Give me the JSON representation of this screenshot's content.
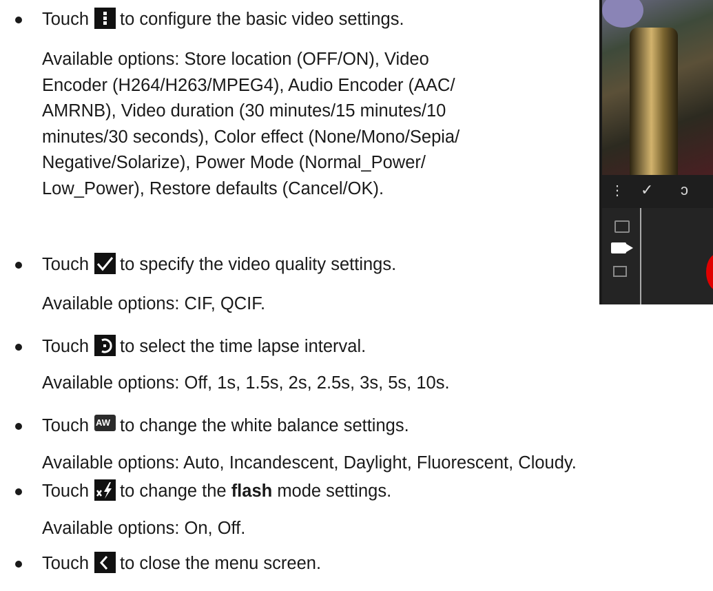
{
  "items": [
    {
      "touch": "Touch",
      "icon": "vertical-dots-menu-icon",
      "rest": "to configure the basic video settings.",
      "options": [
        "Available options: Store location (OFF/ON), Video",
        "Encoder (H264/H263/MPEG4), Audio Encoder (AAC/",
        "AMRNB), Video duration (30 minutes/15 minutes/10",
        "minutes/30 seconds), Color effect (None/Mono/Sepia/",
        "Negative/Solarize), Power Mode (Normal_Power/",
        "Low_Power), Restore defaults (Cancel/OK)."
      ]
    },
    {
      "touch": "Touch",
      "icon": "checkmark-icon",
      "rest": "to specify the video quality settings.",
      "options_text": "Available options: CIF, QCIF."
    },
    {
      "touch": "Touch",
      "icon": "timer-icon",
      "rest": "to select the time lapse interval.",
      "options_text": "Available options: Off, 1s, 1.5s, 2s, 2.5s, 3s, 5s, 10s."
    },
    {
      "touch": "Touch",
      "icon": "white-balance-icon",
      "icon_text": "AW",
      "rest": "to change the white balance settings.",
      "options_text": "Available options: Auto, Incandescent, Daylight, Fluorescent, Cloudy."
    },
    {
      "touch": "Touch",
      "icon": "flash-off-icon",
      "rest_pre": "to change the",
      "rest_bold": "flash",
      "rest_post": "mode settings.",
      "options_text": "Available options: On, Off."
    },
    {
      "touch": "Touch",
      "icon": "back-chevron-icon",
      "rest": "to close the menu screen."
    }
  ],
  "phone_preview": {
    "strip_icons": [
      "vertical-dots-menu-icon",
      "checkmark-icon",
      "timer-icon"
    ],
    "side_icons": [
      "camera-icon",
      "video-camera-icon",
      "panorama-icon"
    ],
    "record_color": "#e00000"
  }
}
